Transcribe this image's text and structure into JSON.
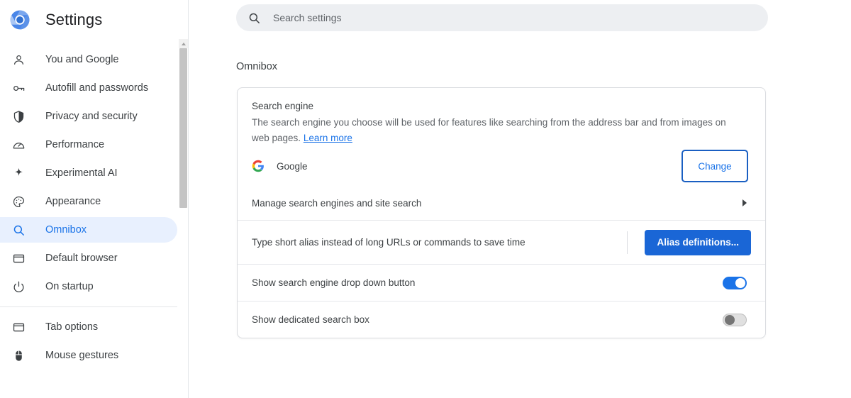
{
  "app": {
    "title": "Settings",
    "logo_icon": "chromium-logo-icon"
  },
  "search": {
    "placeholder": "Search settings",
    "value": "",
    "icon": "search-icon"
  },
  "sidebar": {
    "groups": [
      {
        "items": [
          {
            "label": "You and Google",
            "icon": "person-icon",
            "active": false
          },
          {
            "label": "Autofill and passwords",
            "icon": "key-icon",
            "active": false
          },
          {
            "label": "Privacy and security",
            "icon": "shield-icon",
            "active": false
          },
          {
            "label": "Performance",
            "icon": "speedometer-icon",
            "active": false
          },
          {
            "label": "Experimental AI",
            "icon": "sparkle-icon",
            "active": false
          },
          {
            "label": "Appearance",
            "icon": "palette-icon",
            "active": false
          },
          {
            "label": "Omnibox",
            "icon": "search-icon",
            "active": true
          },
          {
            "label": "Default browser",
            "icon": "browser-window-icon",
            "active": false
          },
          {
            "label": "On startup",
            "icon": "power-icon",
            "active": false
          }
        ]
      },
      {
        "items": [
          {
            "label": "Tab options",
            "icon": "browser-window-icon",
            "active": false
          },
          {
            "label": "Mouse gestures",
            "icon": "mouse-icon",
            "active": false
          }
        ]
      }
    ]
  },
  "main": {
    "section_title": "Omnibox",
    "search_engine": {
      "title": "Search engine",
      "description": "The search engine you choose will be used for features like searching from the address bar and from images on web pages.",
      "learn_more": "Learn more",
      "current_engine": "Google",
      "engine_icon": "google-g-icon",
      "change_label": "Change"
    },
    "manage": {
      "label": "Manage search engines and site search",
      "chevron_icon": "chevron-right-icon"
    },
    "alias": {
      "label": "Type short alias instead of long URLs or commands to save time",
      "button_label": "Alias definitions..."
    },
    "toggles": [
      {
        "label": "Show search engine drop down button",
        "state": "on"
      },
      {
        "label": "Show dedicated search box",
        "state": "off"
      }
    ]
  },
  "colors": {
    "accent": "#1a73e8",
    "accent_dark": "#1a66d6",
    "active_pill": "#e8f0fe",
    "text_primary": "#3c4043",
    "text_secondary": "#5f6368",
    "border": "#dadce0",
    "search_bg": "#edeff2"
  }
}
